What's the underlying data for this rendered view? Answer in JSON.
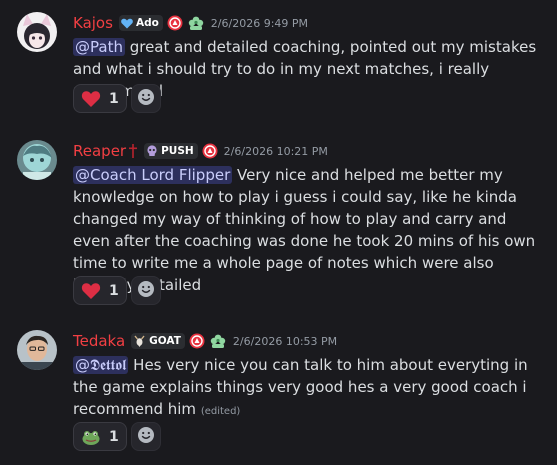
{
  "messages": [
    {
      "username": "Kajos",
      "username_color": "#f23f43",
      "tag": "Ado",
      "tag_icon": "blue-heart-icon",
      "badges": [
        "red-role-badge-icon",
        "green-flower-badge-icon"
      ],
      "timestamp": "2/6/2026 9:49 PM",
      "mention": "@Path",
      "text": " great and detailed coaching, pointed out my mistakes and what i should try to do in my next matches, i really recommend",
      "reaction": {
        "emoji": "red-heart-icon",
        "count": "1"
      }
    },
    {
      "username": "Reaper",
      "username_color": "#f23f43",
      "username_icon": "dagger-icon",
      "tag": "PUSH",
      "tag_icon": "skull-icon",
      "badges": [
        "red-role-badge-icon"
      ],
      "timestamp": "2/6/2026 10:21 PM",
      "mention": "@Coach Lord Flipper",
      "text": " Very nice and helped me better my knowledge on how to play i guess i could say, like he kinda changed my way of thinking of how to play and carry and even after the coaching was done he took 20 mins of his own time to write me a whole page of notes which were also insanely detailed",
      "reaction": {
        "emoji": "red-heart-icon",
        "count": "1"
      }
    },
    {
      "username": "Tedaka",
      "username_color": "#f23f43",
      "tag": "GOAT",
      "tag_icon": "goat-icon",
      "badges": [
        "red-role-badge-icon",
        "green-flower-badge-icon"
      ],
      "timestamp": "2/6/2026 10:53 PM",
      "mention": "@𝕯𝖊𝖙𝖙𝖔𝖑",
      "text": " Hes very nice you can talk to him about everyting in the game explains things very good  hes a very good coach i recommend him",
      "edited": "(edited)",
      "reaction": {
        "emoji": "frog-emoji-icon",
        "count": "1"
      }
    }
  ]
}
